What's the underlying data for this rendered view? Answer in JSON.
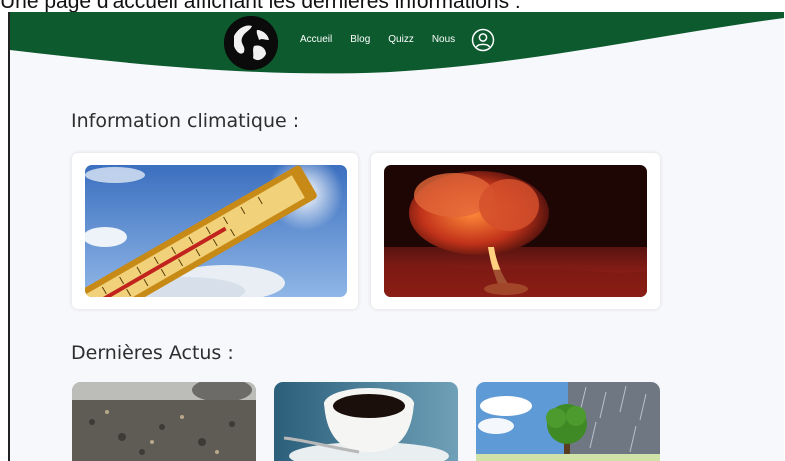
{
  "caption": "Une page d'accueil affichant les dernières informations :",
  "header": {
    "logo_name": "earth-globe-icon",
    "nav": [
      "Accueil",
      "Blog",
      "Quizz",
      "Nous"
    ],
    "account_icon": "user-account-icon",
    "color": "#0c5a2e"
  },
  "climate": {
    "title": "Information climatique :",
    "cards": [
      {
        "image": "thermometer-sky-image"
      },
      {
        "image": "volcano-eruption-image"
      }
    ]
  },
  "news": {
    "title": "Dernières Actus :",
    "cards": [
      {
        "image": "landfill-waste-image"
      },
      {
        "image": "coffee-cup-image"
      },
      {
        "image": "tree-weather-image"
      }
    ]
  }
}
